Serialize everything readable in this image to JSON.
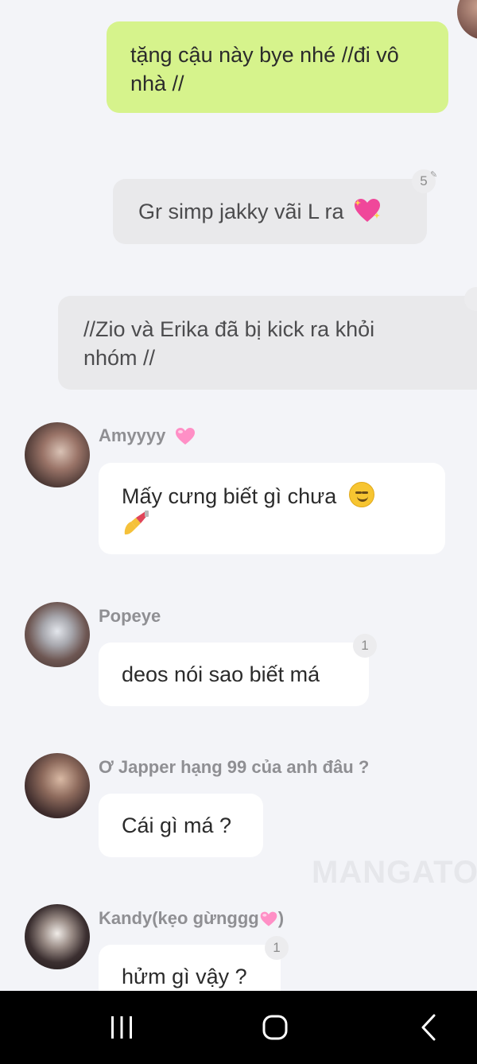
{
  "messages": {
    "m1": {
      "text": "tặng cậu này bye nhé //đi vô nhà //"
    },
    "m2": {
      "text": "Gr simp jakky vãi L ra",
      "emoji": "sparkling-heart",
      "reaction_count": "5"
    },
    "m3": {
      "text": "//Zio và Erika đã bị kick ra khỏi nhóm //"
    },
    "m4": {
      "sender": "Amyyyy",
      "sender_emoji": "pink-heart",
      "text": "Mấy cưng biết gì chưa",
      "emoji": [
        "smirk",
        "nail-polish"
      ]
    },
    "m5": {
      "sender": "Popeye",
      "text": "deos nói sao biết má",
      "reaction_count": "1"
    },
    "m6": {
      "sender": "Ơ Japper hạng 99 của anh đâu ?",
      "text": "Cái gì má ?"
    },
    "m7": {
      "sender_prefix": "Kandy(kẹo gừnggg",
      "sender_emoji": "pink-heart",
      "sender_suffix": ")",
      "text": "hửm gì vậy ?",
      "reaction_count": "1"
    }
  },
  "watermark": "MANGATOO",
  "navbar": {
    "icons": [
      "recent-apps-icon",
      "home-icon",
      "back-icon"
    ]
  },
  "colors": {
    "background": "#f3f4f8",
    "my_bubble": "#d6f38c",
    "system_bubble": "#e9e9eb",
    "other_bubble": "#ffffff",
    "navbar": "#000000"
  }
}
